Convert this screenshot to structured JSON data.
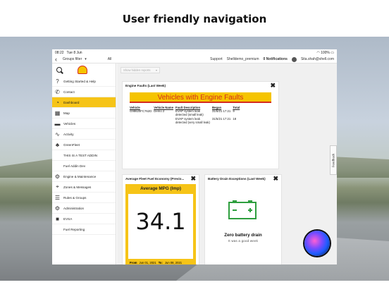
{
  "headline": "User friendly navigation",
  "statusbar": {
    "time": "08:22",
    "date": "Tue 8 Jun",
    "battery": "100%"
  },
  "topbar": {
    "groups_filter": "Groups filter",
    "groups_value": "All",
    "support": "Support",
    "user_db": "Shelldemo_premium",
    "notifications": "0 Notifications",
    "email": "Sita.shah@shell.com"
  },
  "sidebar": {
    "items": [
      {
        "label": "Getting Started & Help",
        "icon": "help-icon"
      },
      {
        "label": "Contact",
        "icon": "phone-icon"
      },
      {
        "label": "Dashboard",
        "icon": "dashboard-icon"
      },
      {
        "label": "Map",
        "icon": "map-icon"
      },
      {
        "label": "Vehicles",
        "icon": "truck-icon"
      },
      {
        "label": "Activity",
        "icon": "activity-icon"
      },
      {
        "label": "GreenFleet",
        "icon": "greenfleet-icon"
      },
      {
        "label": "THIS IS A TEST ADDIN",
        "icon": ""
      },
      {
        "label": "Fuel Addin Dev",
        "icon": ""
      },
      {
        "label": "Engine & Maintenance",
        "icon": "engine-icon"
      },
      {
        "label": "Zones & Messages",
        "icon": "zones-icon"
      },
      {
        "label": "Rules & Groups",
        "icon": "rules-icon"
      },
      {
        "label": "Administration",
        "icon": "gear-icon"
      },
      {
        "label": "EVSA",
        "icon": "evsa-icon"
      },
      {
        "label": "Fuel Reporting",
        "icon": ""
      }
    ]
  },
  "report_selector": {
    "placeholder": "Show hidden reports"
  },
  "engine_faults": {
    "title": "Engine Faults (Last Week)",
    "banner": "Vehicles with Engine Faults",
    "columns": [
      "Vehicle",
      "Vehicle Name",
      "Fault Description",
      "Began",
      "Total"
    ],
    "rows": [
      [
        "G98620FC762D",
        "Demo 2",
        "EVAP system leak detected (small leak)",
        "31/5/21 17:21",
        "9"
      ],
      [
        "",
        "",
        "EVAP system leak detected (very small leak)",
        "31/5/21 17:21",
        "18"
      ]
    ]
  },
  "fuel_economy": {
    "title": "Average Fleet Fuel Economy (Previo...",
    "header": "Average MPG (Imp)",
    "value": "34.1",
    "from_label": "From",
    "from_date": "Jun 01, 2021",
    "to_label": "To:",
    "to_date": "Jun 08, 2021"
  },
  "battery_drain": {
    "title": "Battery Drain Exceptions (Last Week)",
    "headline": "Zero battery drain",
    "subtext": "It was a good week"
  },
  "feedback_label": "Feedback",
  "colors": {
    "shell_yellow": "#f6c417",
    "shell_red": "#d52b1e",
    "battery_green": "#2e9e3e"
  }
}
